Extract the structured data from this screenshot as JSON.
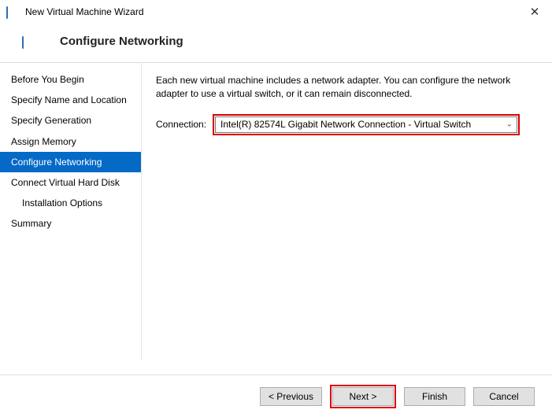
{
  "titlebar": {
    "title": "New Virtual Machine Wizard",
    "close_glyph": "✕"
  },
  "header": {
    "heading": "Configure Networking"
  },
  "sidebar": {
    "steps": [
      "Before You Begin",
      "Specify Name and Location",
      "Specify Generation",
      "Assign Memory",
      "Configure Networking",
      "Connect Virtual Hard Disk",
      "Installation Options",
      "Summary"
    ],
    "active_index": 4,
    "indent_indices": [
      6
    ]
  },
  "main": {
    "description": "Each new virtual machine includes a network adapter. You can configure the network adapter to use a virtual switch, or it can remain disconnected.",
    "connection_label": "Connection:",
    "connection_value": "Intel(R) 82574L Gigabit Network Connection - Virtual Switch"
  },
  "footer": {
    "previous": "< Previous",
    "next": "Next >",
    "finish": "Finish",
    "cancel": "Cancel"
  }
}
